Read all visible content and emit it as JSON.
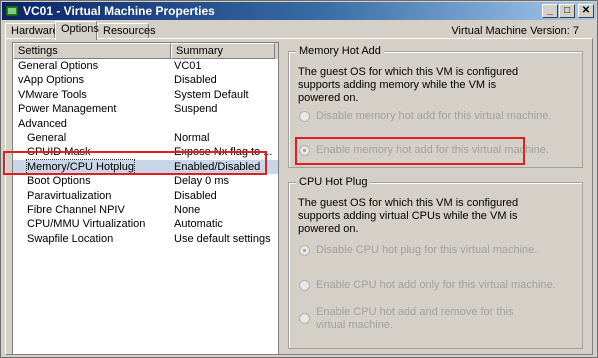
{
  "window": {
    "title": "VC01 - Virtual Machine Properties",
    "buttons": {
      "minimize": "_",
      "maximize": "□",
      "close": "✕"
    }
  },
  "tabs": [
    {
      "label": "Hardware",
      "active": false
    },
    {
      "label": "Options",
      "active": true
    },
    {
      "label": "Resources",
      "active": false
    }
  ],
  "vm_version": "Virtual Machine Version: 7",
  "settings_list": {
    "headers": {
      "settings": "Settings",
      "summary": "Summary"
    },
    "rows": [
      {
        "setting": "General Options",
        "summary": "VC01"
      },
      {
        "setting": "vApp Options",
        "summary": "Disabled"
      },
      {
        "setting": "VMware Tools",
        "summary": "System Default"
      },
      {
        "setting": "Power Management",
        "summary": "Suspend"
      },
      {
        "setting": "Advanced",
        "summary": ""
      },
      {
        "setting": "General",
        "summary": "Normal"
      },
      {
        "setting": "CPUID Mask",
        "summary": "Expose Nx flag to ..."
      },
      {
        "setting": "Memory/CPU Hotplug",
        "summary": "Enabled/Disabled",
        "selected": true
      },
      {
        "setting": "Boot Options",
        "summary": "Delay 0 ms"
      },
      {
        "setting": "Paravirtualization",
        "summary": "Disabled"
      },
      {
        "setting": "Fibre Channel NPIV",
        "summary": "None"
      },
      {
        "setting": "CPU/MMU Virtualization",
        "summary": "Automatic"
      },
      {
        "setting": "Swapfile Location",
        "summary": "Use default settings"
      }
    ]
  },
  "memory_hot_add": {
    "title": "Memory Hot Add",
    "description": "The guest OS for which this VM is configured supports adding memory while the VM is powered on.",
    "options": [
      {
        "label": "Disable memory hot add for this virtual machine.",
        "checked": false
      },
      {
        "label": "Enable memory hot add for this virtual machine.",
        "checked": true
      }
    ]
  },
  "cpu_hot_plug": {
    "title": "CPU Hot Plug",
    "description": "The guest OS for which this VM is configured supports adding virtual CPUs while the VM is powered on.",
    "options": [
      {
        "label": "Disable CPU hot plug for this virtual machine.",
        "checked": true
      },
      {
        "label": "Enable CPU hot add only for this virtual machine.",
        "checked": false
      },
      {
        "label": "Enable CPU hot add and remove for this virtual machine.",
        "checked": false
      }
    ]
  },
  "colors": {
    "title_bar_start": "#0a246a",
    "title_bar_end": "#a6caf0",
    "selection": "#c9d6e8",
    "annotation_red": "#e02020",
    "disabled_text": "#a0a0a0"
  }
}
